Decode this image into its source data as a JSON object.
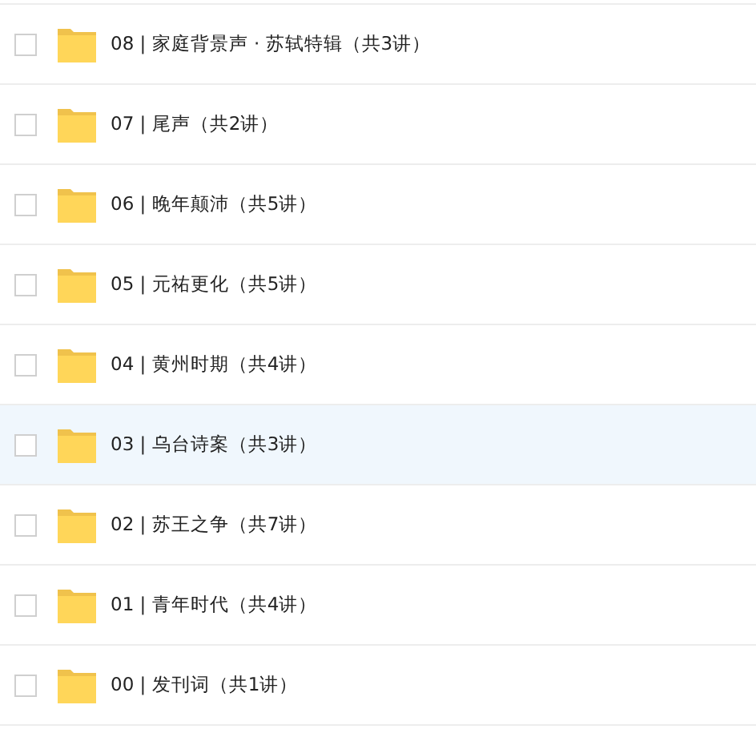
{
  "folders": [
    {
      "name": "08 | 家庭背景声 · 苏轼特辑（共3讲）",
      "selected": false,
      "checked": false
    },
    {
      "name": "07 | 尾声（共2讲）",
      "selected": false,
      "checked": false
    },
    {
      "name": "06 | 晚年颠沛（共5讲）",
      "selected": false,
      "checked": false
    },
    {
      "name": "05 | 元祐更化（共5讲）",
      "selected": false,
      "checked": false
    },
    {
      "name": "04 | 黄州时期（共4讲）",
      "selected": false,
      "checked": false
    },
    {
      "name": "03 | 乌台诗案（共3讲）",
      "selected": true,
      "checked": false
    },
    {
      "name": "02 | 苏王之争（共7讲）",
      "selected": false,
      "checked": false
    },
    {
      "name": "01 | 青年时代（共4讲）",
      "selected": false,
      "checked": false
    },
    {
      "name": "00 | 发刊词（共1讲）",
      "selected": false,
      "checked": false
    }
  ]
}
